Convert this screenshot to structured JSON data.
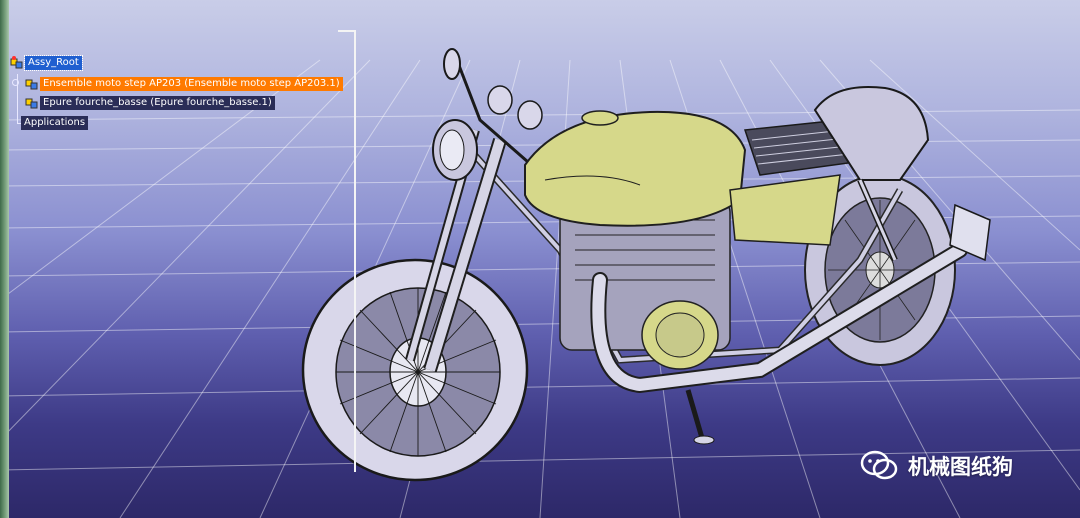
{
  "tree": {
    "root": {
      "label": "Assy_Root"
    },
    "children": [
      {
        "label": "Ensemble moto step AP203 (Ensemble moto step AP203.1)"
      },
      {
        "label": "Epure fourche_basse (Epure fourche_basse.1)"
      }
    ],
    "applications": {
      "label": "Applications"
    }
  },
  "watermark": {
    "text": "机械图纸狗"
  },
  "colors": {
    "selection": "#1f5fd0",
    "highlight": "#ff7a00",
    "tank": "#d6d88a",
    "wheel": "#d9d7ea"
  }
}
